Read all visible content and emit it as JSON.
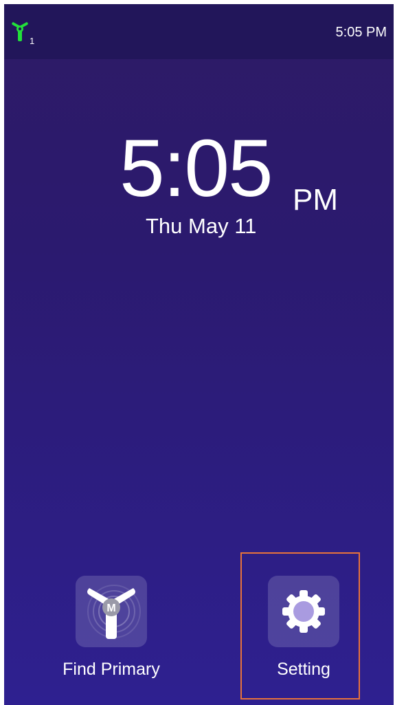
{
  "status_bar": {
    "network_icon": "tri-blade-network-icon",
    "network_index": "1",
    "time": "5:05 PM"
  },
  "clock": {
    "time": "5:05",
    "ampm": "PM",
    "date": "Thu May 11"
  },
  "apps": [
    {
      "label": "Find Primary",
      "icon": "find-primary-icon"
    },
    {
      "label": "Setting",
      "icon": "gear-icon"
    }
  ],
  "colors": {
    "status_icon": "#22e03a",
    "highlight_frame": "#e8733a",
    "background_top": "#2e1b66",
    "background_bottom": "#2e2090"
  }
}
